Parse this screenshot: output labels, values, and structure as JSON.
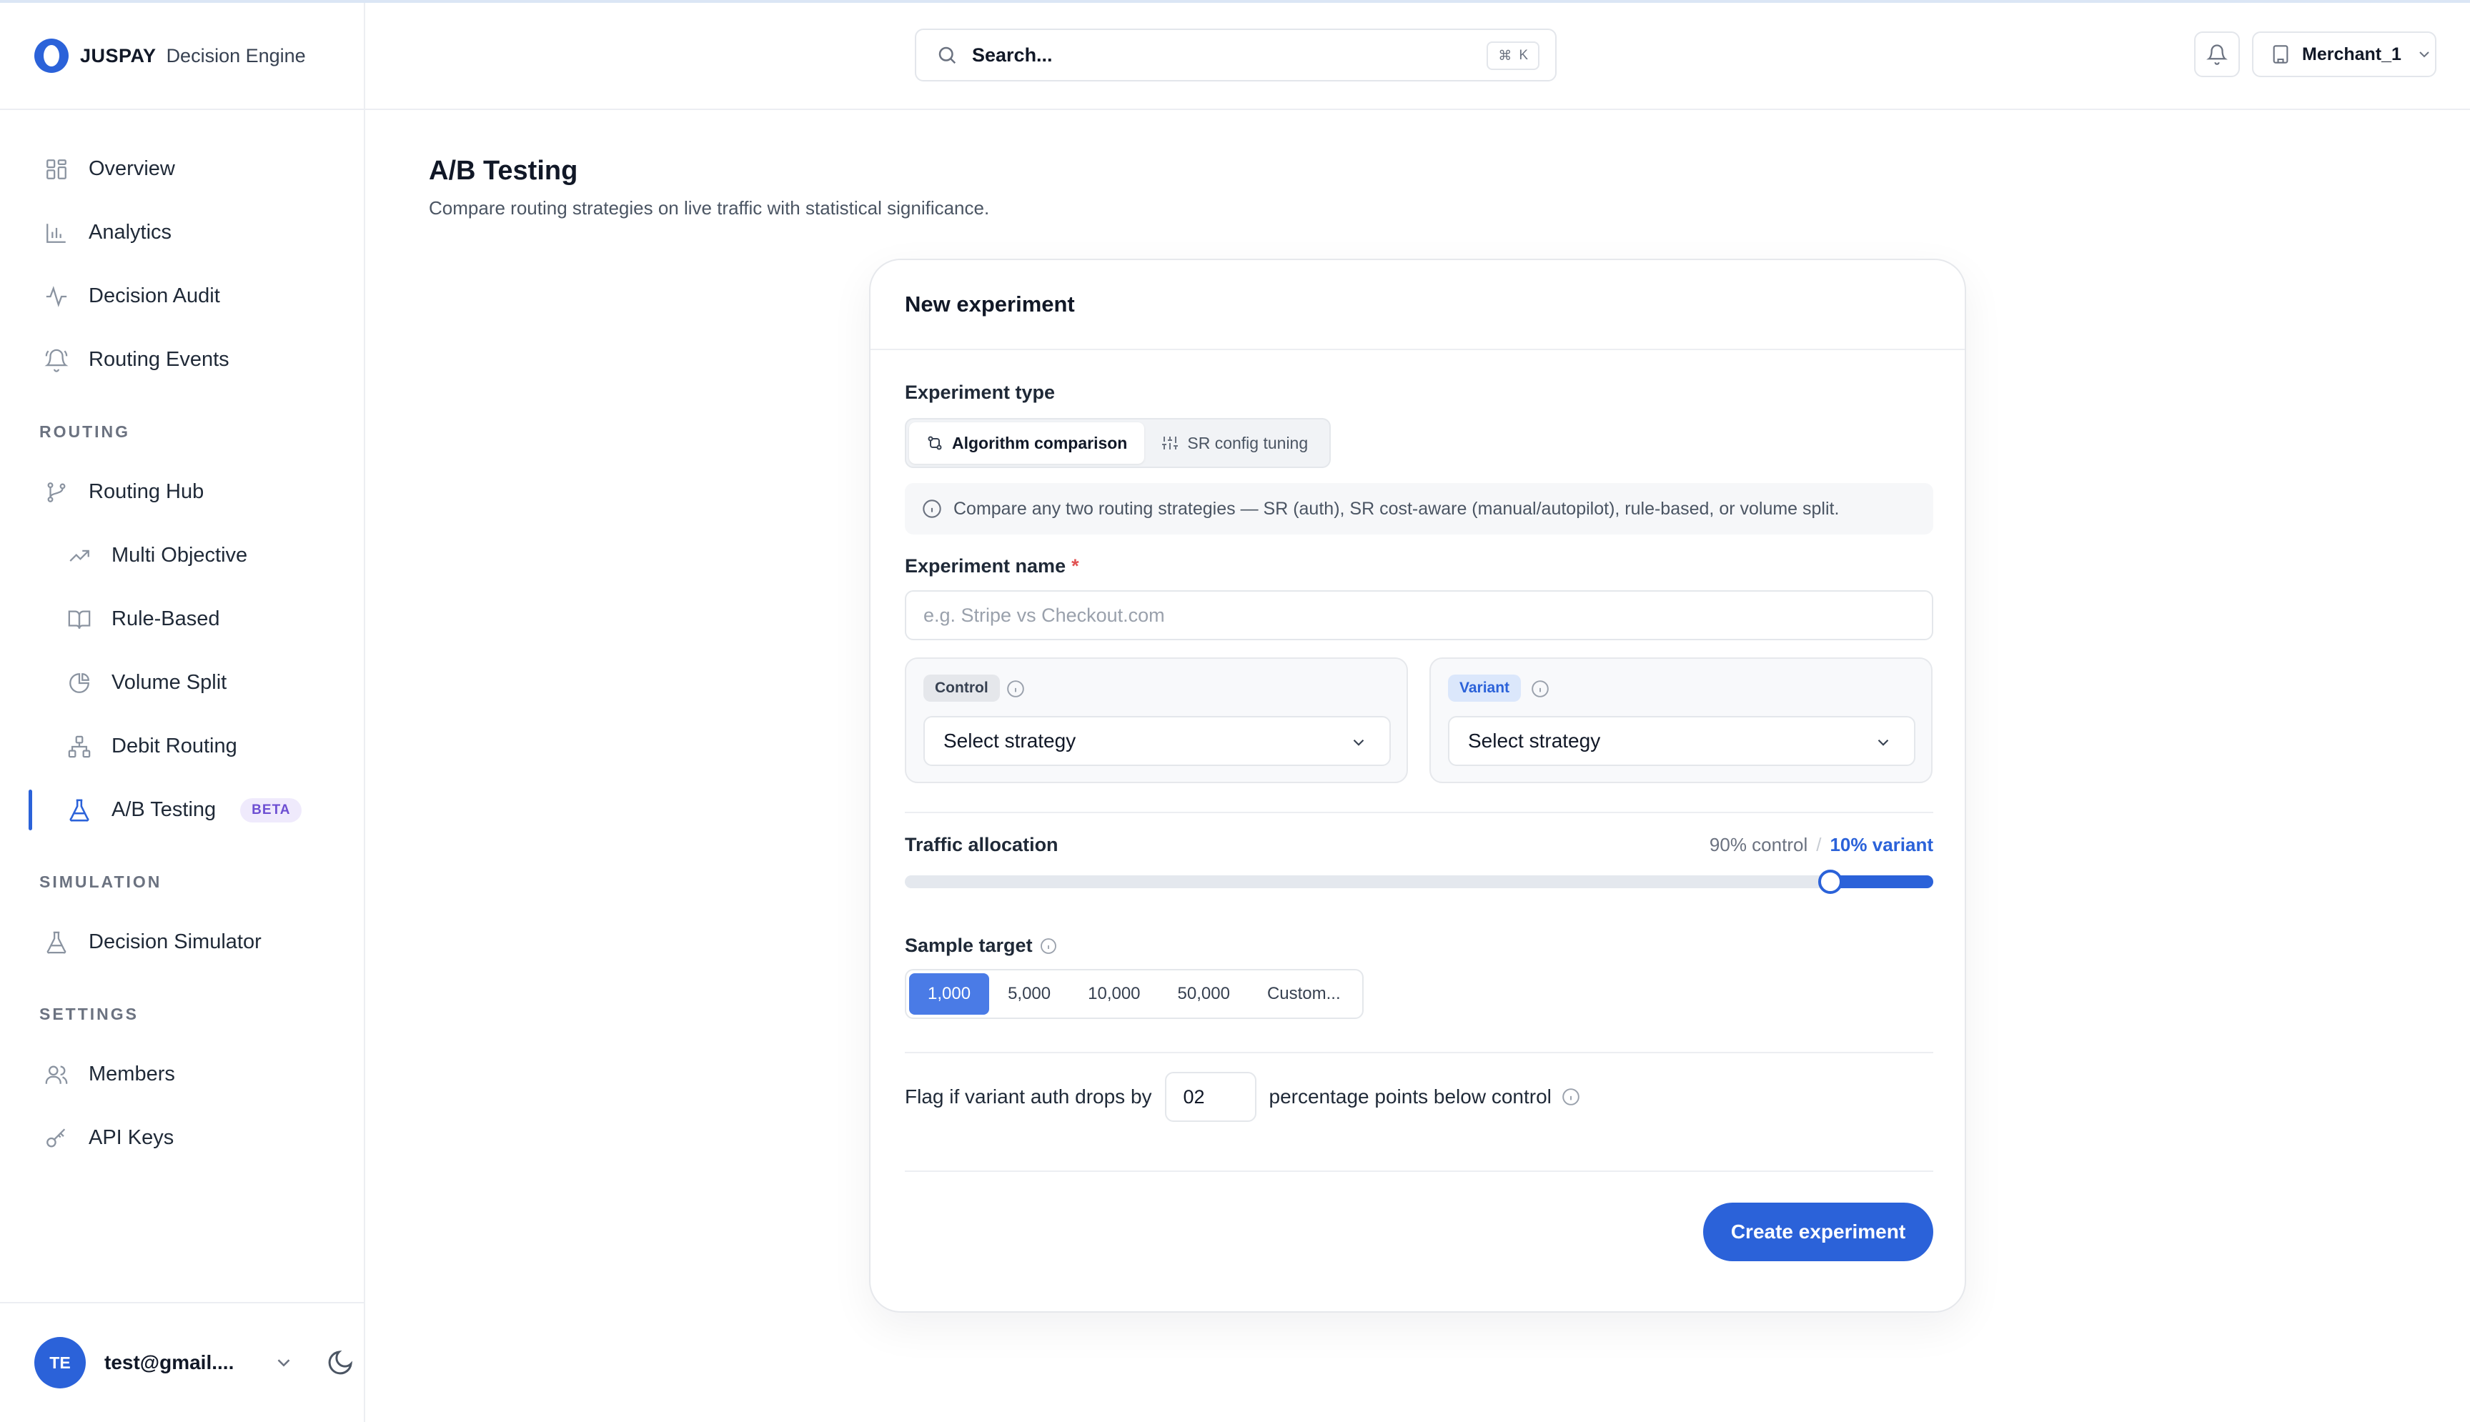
{
  "app": {
    "brand": "JUSPAY",
    "product": "Decision Engine"
  },
  "search": {
    "placeholder": "Search...",
    "shortcut_mod": "⌘",
    "shortcut_key": "K"
  },
  "header": {
    "merchant": "Merchant_1"
  },
  "sidebar": {
    "main_items": [
      {
        "label": "Overview"
      },
      {
        "label": "Analytics"
      },
      {
        "label": "Decision Audit"
      },
      {
        "label": "Routing Events"
      }
    ],
    "routing": {
      "title": "ROUTING",
      "hub": "Routing Hub",
      "items": [
        {
          "label": "Multi Objective"
        },
        {
          "label": "Rule-Based"
        },
        {
          "label": "Volume Split"
        },
        {
          "label": "Debit Routing"
        },
        {
          "label": "A/B Testing",
          "badge": "BETA"
        }
      ]
    },
    "simulation": {
      "title": "SIMULATION",
      "items": [
        {
          "label": "Decision Simulator"
        }
      ]
    },
    "settings": {
      "title": "SETTINGS",
      "items": [
        {
          "label": "Members"
        },
        {
          "label": "API Keys"
        }
      ]
    },
    "user": {
      "initials": "TE",
      "email": "test@gmail...."
    }
  },
  "page": {
    "title": "A/B Testing",
    "subtitle": "Compare routing strategies on live traffic with statistical significance."
  },
  "form": {
    "card_title": "New experiment",
    "experiment_type_label": "Experiment type",
    "types": [
      {
        "label": "Algorithm comparison",
        "active": true
      },
      {
        "label": "SR config tuning",
        "active": false
      }
    ],
    "info_note": "Compare any two routing strategies — SR (auth), SR cost-aware (manual/autopilot), rule-based, or volume split.",
    "name_label": "Experiment name",
    "name_required_mark": "*",
    "name_placeholder": "e.g. Stripe vs Checkout.com",
    "control": {
      "pill": "Control",
      "select": "Select strategy"
    },
    "variant": {
      "pill": "Variant",
      "select": "Select strategy"
    },
    "traffic": {
      "label": "Traffic allocation",
      "control_text": "90% control",
      "separator": "/",
      "variant_text": "10% variant",
      "variant_fraction": 0.1
    },
    "sample": {
      "label": "Sample target",
      "options": [
        {
          "label": "1,000",
          "active": true
        },
        {
          "label": "5,000",
          "active": false
        },
        {
          "label": "10,000",
          "active": false
        },
        {
          "label": "50,000",
          "active": false
        },
        {
          "label": "Custom...",
          "active": false
        }
      ]
    },
    "flag": {
      "prefix": "Flag if variant auth drops by",
      "value": "02",
      "suffix": "percentage points below control"
    },
    "submit_label": "Create experiment"
  },
  "colors": {
    "accent": "#2b62d9",
    "beta_badge": "#6d4fd2",
    "sample_active": "#4a7be6"
  }
}
